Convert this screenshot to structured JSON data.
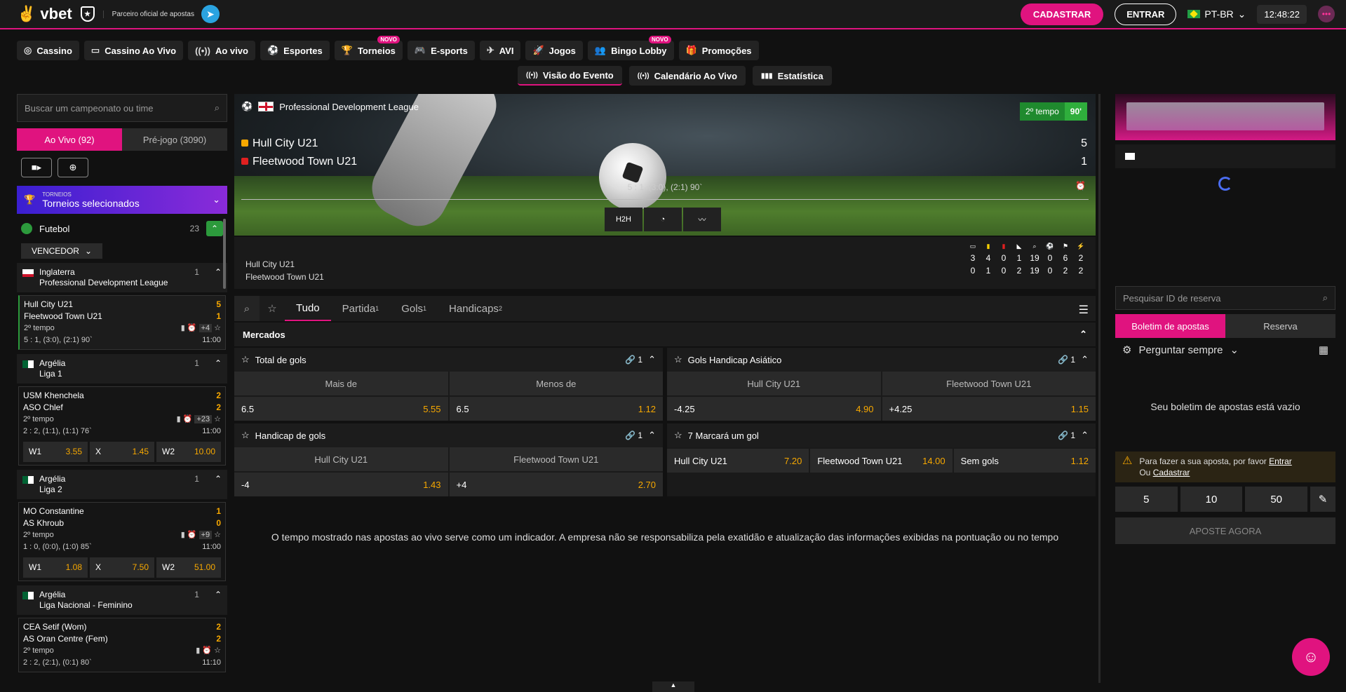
{
  "header": {
    "logo": "vbet",
    "partner": "Parceiro oficial de apostas",
    "register": "CADASTRAR",
    "login": "ENTRAR",
    "language": "PT-BR",
    "time": "12:48:22"
  },
  "nav": [
    {
      "label": "Cassino",
      "icon": "chip-icon",
      "glyph": "◎"
    },
    {
      "label": "Cassino Ao Vivo",
      "icon": "tv-icon",
      "glyph": "▭"
    },
    {
      "label": "Ao vivo",
      "icon": "broadcast-icon",
      "glyph": "((•))"
    },
    {
      "label": "Esportes",
      "icon": "soccer-icon",
      "glyph": "⚽"
    },
    {
      "label": "Torneios",
      "icon": "trophy-icon",
      "glyph": "🏆",
      "badge": "NOVO"
    },
    {
      "label": "E-sports",
      "icon": "gamepad-icon",
      "glyph": "🎮"
    },
    {
      "label": "AVI",
      "icon": "plane-icon",
      "glyph": "✈"
    },
    {
      "label": "Jogos",
      "icon": "rocket-icon",
      "glyph": "🚀"
    },
    {
      "label": "Bingo Lobby",
      "icon": "people-icon",
      "glyph": "👥",
      "badge": "NOVO"
    },
    {
      "label": "Promoções",
      "icon": "gift-icon",
      "glyph": "🎁"
    }
  ],
  "subnav": [
    {
      "label": "Visão do Evento",
      "glyph": "((•))"
    },
    {
      "label": "Calendário Ao Vivo",
      "glyph": "((•))"
    },
    {
      "label": "Estatística",
      "glyph": "▮▮▮"
    }
  ],
  "sidebar": {
    "search_placeholder": "Buscar um campeonato ou time",
    "live_tab": "Ao Vivo (92)",
    "pre_tab": "Pré-jogo (3090)",
    "tournaments_small": "TORNEIOS",
    "tournaments": "Torneios selecionados",
    "sport": "Futebol",
    "sport_count": "23",
    "filter": "VENCEDOR",
    "leagues": [
      {
        "country": "Inglaterra",
        "name": "Professional Development League",
        "count": "1",
        "matches": [
          {
            "home": "Hull City U21",
            "away": "Fleetwood Town U21",
            "hs": "5",
            "as": "1",
            "period": "2º tempo",
            "more": "+4",
            "score_detail": "5 : 1, (3:0), (2:1) 90`",
            "time": "11:00",
            "odds": []
          }
        ]
      },
      {
        "country": "Argélia",
        "name": "Liga 1",
        "count": "1",
        "matches": [
          {
            "home": "USM Khenchela",
            "away": "ASO Chlef",
            "hs": "2",
            "as": "2",
            "period": "2º tempo",
            "more": "+23",
            "score_detail": "2 : 2, (1:1), (1:1) 76`",
            "time": "11:00",
            "odds": [
              [
                "W1",
                "3.55"
              ],
              [
                "X",
                "1.45"
              ],
              [
                "W2",
                "10.00"
              ]
            ]
          }
        ]
      },
      {
        "country": "Argélia",
        "name": "Liga 2",
        "count": "1",
        "matches": [
          {
            "home": "MO Constantine",
            "away": "AS Khroub",
            "hs": "1",
            "as": "0",
            "period": "2º tempo",
            "more": "+9",
            "score_detail": "1 : 0, (0:0), (1:0) 85`",
            "time": "11:00",
            "odds": [
              [
                "W1",
                "1.08"
              ],
              [
                "X",
                "7.50"
              ],
              [
                "W2",
                "51.00"
              ]
            ]
          }
        ]
      },
      {
        "country": "Argélia",
        "name": "Liga Nacional - Feminino",
        "count": "1",
        "matches": [
          {
            "home": "CEA Setif (Wom)",
            "away": "AS Oran Centre (Fem)",
            "hs": "2",
            "as": "2",
            "period": "2º tempo",
            "more": "",
            "score_detail": "2 : 2, (2:1), (0:1) 80`",
            "time": "11:10",
            "odds": []
          }
        ]
      }
    ]
  },
  "event": {
    "league": "Professional Development League",
    "period": "2º tempo",
    "minute": "90'",
    "home": "Hull City U21",
    "away": "Fleetwood Town U21",
    "home_score": "5",
    "away_score": "1",
    "score_detail": "5 : 1, (3:0), (2:1) 90`",
    "h2h": "H2H",
    "stats_home": [
      "3",
      "4",
      "0",
      "1",
      "19",
      "0",
      "6",
      "2"
    ],
    "stats_away": [
      "0",
      "1",
      "0",
      "2",
      "19",
      "0",
      "2",
      "2"
    ]
  },
  "tabs": {
    "all": "Tudo",
    "match": "Partida",
    "match_sup": "1",
    "goals": "Gols",
    "goals_sup": "1",
    "handicaps": "Handicaps",
    "handicaps_sup": "2"
  },
  "markets_title": "Mercados",
  "markets": [
    {
      "title": "Total de gols",
      "links": "1",
      "cols": [
        "Mais de",
        "Menos de"
      ],
      "rows": [
        [
          [
            "6.5",
            "5.55"
          ],
          [
            "6.5",
            "1.12"
          ]
        ]
      ]
    },
    {
      "title": "Gols Handicap Asiático",
      "links": "1",
      "cols": [
        "Hull City U21",
        "Fleetwood Town U21"
      ],
      "rows": [
        [
          [
            "-4.25",
            "4.90"
          ],
          [
            "+4.25",
            "1.15"
          ]
        ]
      ]
    },
    {
      "title": "Handicap de gols",
      "links": "1",
      "cols": [
        "Hull City U21",
        "Fleetwood Town U21"
      ],
      "rows": [
        [
          [
            "-4",
            "1.43"
          ],
          [
            "+4",
            "2.70"
          ]
        ]
      ]
    },
    {
      "title": "7 Marcará um gol",
      "links": "1",
      "cols": [],
      "rows": [
        [
          [
            "Hull City U21",
            "7.20"
          ],
          [
            "Fleetwood Town U21",
            "14.00"
          ],
          [
            "Sem gols",
            "1.12"
          ]
        ]
      ]
    }
  ],
  "disclaimer": "O tempo mostrado nas apostas ao vivo serve como um indicador. A empresa não se responsabiliza pela exatidão e atualização das informações exibidas na pontuação ou no tempo",
  "betslip": {
    "search_placeholder": "Pesquisar ID de reserva",
    "tab_slip": "Boletim de apostas",
    "tab_reserve": "Reserva",
    "ask": "Perguntar sempre",
    "empty": "Seu boletim de apostas está vazio",
    "warn_text": "Para fazer a sua aposta, por favor",
    "warn_login": "Entrar",
    "warn_or": "Ou",
    "warn_register": "Cadastrar",
    "stakes": [
      "5",
      "10",
      "50"
    ],
    "place": "APOSTE AGORA"
  },
  "colors": {
    "accent": "#e0137f",
    "odds": "#f7a800",
    "live_green": "#2c9a3c"
  }
}
